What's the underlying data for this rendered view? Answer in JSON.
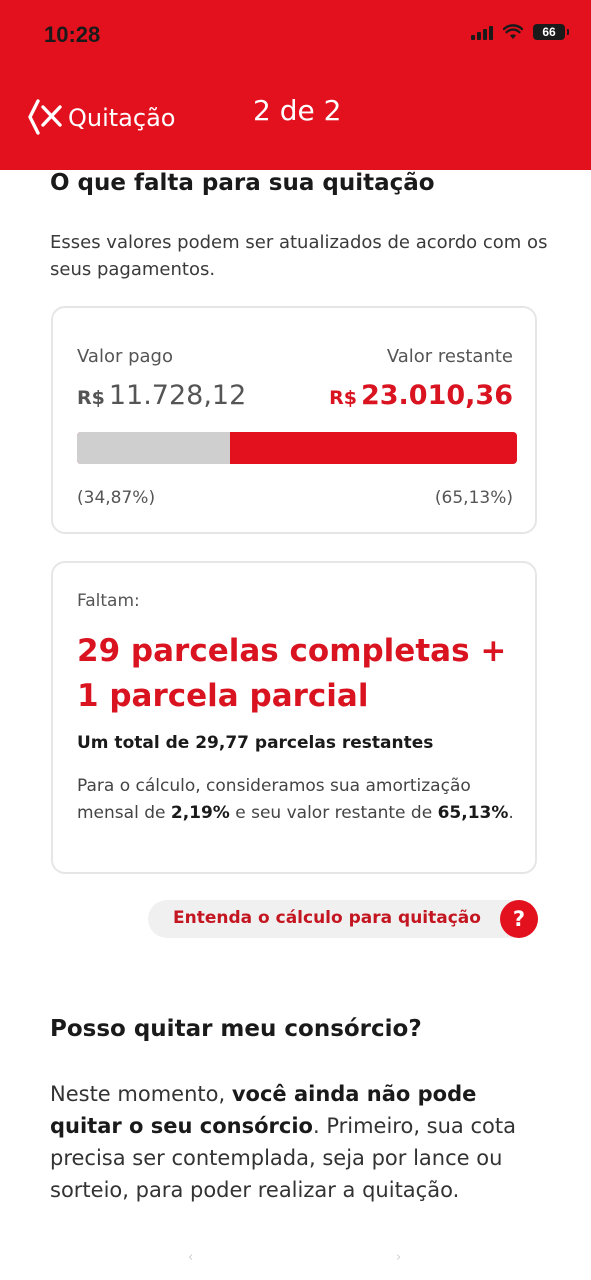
{
  "status": {
    "time": "10:28",
    "battery": "66"
  },
  "header": {
    "title": "Quitação",
    "step": "2 de 2"
  },
  "section1": {
    "title": "O que falta para sua quitação",
    "subtitle": "Esses valores podem ser atualizados de acordo com os seus pagamentos."
  },
  "summary": {
    "paid_label": "Valor pago",
    "remaining_label": "Valor restante",
    "currency": "R$",
    "paid_value": "11.728,12",
    "remaining_value": "23.010,36",
    "paid_pct": "(34,87%)",
    "remaining_pct": "(65,13%)",
    "paid_fraction": 0.3487,
    "colors": {
      "paid": "#cfcfcf",
      "remaining": "#e3101e"
    }
  },
  "installments": {
    "label": "Faltam:",
    "headline": "29 parcelas completas + 1 parcela parcial",
    "total": "Um total de 29,77 parcelas restantes",
    "calc_prefix": "Para o cálculo, consideramos sua amortização mensal de ",
    "calc_rate": "2,19%",
    "calc_mid": " e seu valor restante de ",
    "calc_pct": "65,13%",
    "calc_suffix": "."
  },
  "help_link": {
    "label": "Entenda o cálculo para quitação",
    "icon": "?"
  },
  "section2": {
    "title": "Posso quitar meu consórcio?",
    "p1": "Neste momento, ",
    "p_bold": "você ainda não pode quitar o seu consórcio",
    "p2": ". Primeiro, sua cota precisa ser contemplada, seja por lance ou sorteio, para poder realizar a quitação."
  },
  "bottom_nav": {
    "prev": "‹",
    "next": "›"
  }
}
